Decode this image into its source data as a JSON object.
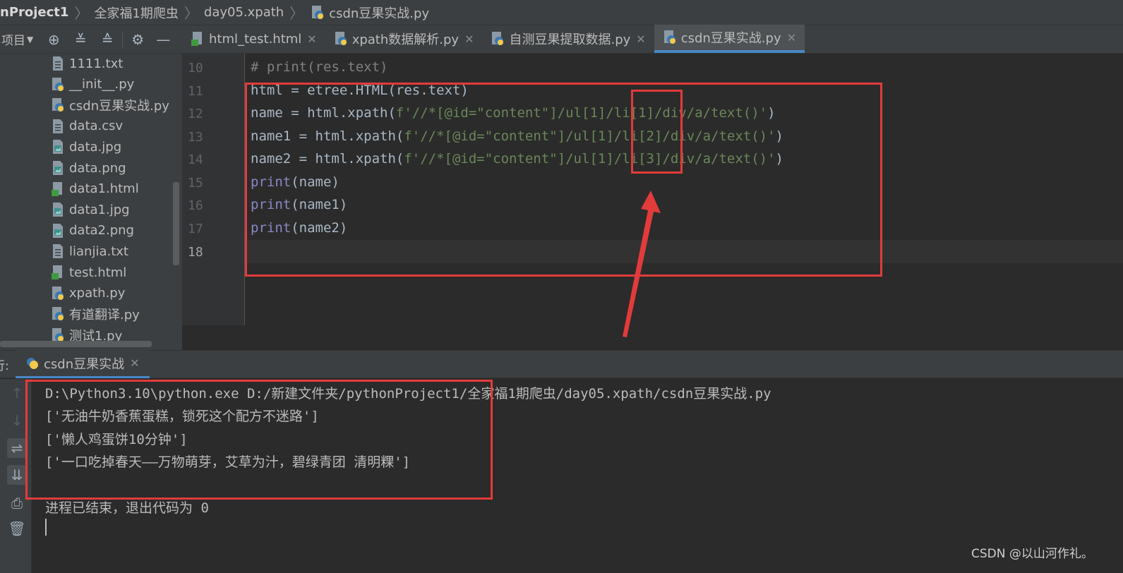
{
  "breadcrumb": [
    "nProject1",
    "全家福1期爬虫",
    "day05.xpath",
    "csdn豆果实战.py"
  ],
  "project_panel": {
    "title": "项目",
    "files": [
      {
        "name": "1111.txt",
        "type": "txt"
      },
      {
        "name": "__init__.py",
        "type": "py"
      },
      {
        "name": "csdn豆果实战.py",
        "type": "py"
      },
      {
        "name": "data.csv",
        "type": "txt"
      },
      {
        "name": "data.jpg",
        "type": "img"
      },
      {
        "name": "data.png",
        "type": "img"
      },
      {
        "name": "data1.html",
        "type": "html"
      },
      {
        "name": "data1.jpg",
        "type": "img"
      },
      {
        "name": "data2.png",
        "type": "img"
      },
      {
        "name": "lianjia.txt",
        "type": "txt"
      },
      {
        "name": "test.html",
        "type": "html"
      },
      {
        "name": "xpath.py",
        "type": "py"
      },
      {
        "name": "有道翻译.py",
        "type": "py"
      },
      {
        "name": "测试1.py",
        "type": "py"
      }
    ]
  },
  "tabs": [
    {
      "label": "html_test.html",
      "active": false
    },
    {
      "label": "xpath数据解析.py",
      "active": false
    },
    {
      "label": "自测豆果提取数据.py",
      "active": false
    },
    {
      "label": "csdn豆果实战.py",
      "active": true
    }
  ],
  "editor": {
    "line_numbers": [
      "10",
      "11",
      "12",
      "13",
      "14",
      "15",
      "16",
      "17",
      "18"
    ],
    "lines": {
      "l10": "# print(res.text)",
      "l11": "html = etree.HTML(res.text)",
      "l12_pre": "name = html.xpath(",
      "l12_str": "f'//*[@id=\"content\"]/ul[1]/li[1]/div/a/text()'",
      "l12_post": ")",
      "l13_pre": "name1 = html.xpath(",
      "l13_str": "f'//*[@id=\"content\"]/ul[1]/li[2]/div/a/text()'",
      "l13_post": ")",
      "l14_pre": "name2 = html.xpath(",
      "l14_str": "f'//*[@id=\"content\"]/ul[1]/li[3]/div/a/text()'",
      "l14_post": ")",
      "l15_kw": "print",
      "l15_arg": "(name)",
      "l16_kw": "print",
      "l16_arg": "(name1)",
      "l17_kw": "print",
      "l17_arg": "(name2)"
    }
  },
  "run_panel": {
    "label": "行:",
    "tab": "csdn豆果实战",
    "output": [
      "D:\\Python3.10\\python.exe D:/新建文件夹/pythonProject1/全家福1期爬虫/day05.xpath/csdn豆果实战.py",
      "['无油牛奶香蕉蛋糕，锁死这个配方不迷路']",
      "['懒人鸡蛋饼10分钟']",
      "['一口吃掉春天——万物萌芽，艾草为汁，碧绿青团 清明粿']",
      "",
      "进程已结束，退出代码为 0"
    ]
  },
  "watermark": "CSDN @以山河作礼。",
  "colors": {
    "accent": "#4a88c7",
    "annotation": "#e23b3b",
    "bg": "#2b2b2b"
  }
}
